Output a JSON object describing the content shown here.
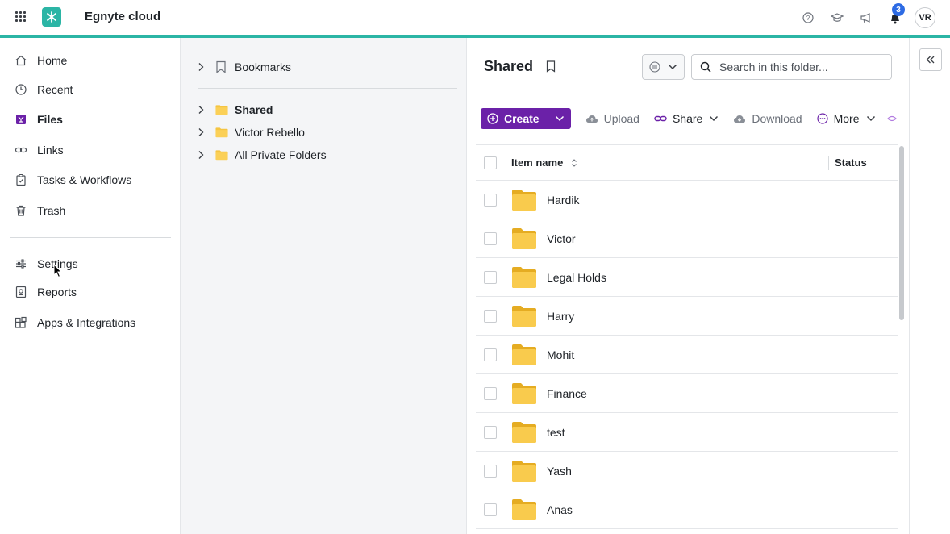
{
  "header": {
    "brand": "Egnyte cloud",
    "notification_count": "3",
    "avatar_initials": "VR"
  },
  "sidebar": {
    "items": [
      {
        "label": "Home",
        "icon": "home-icon"
      },
      {
        "label": "Recent",
        "icon": "clock-icon"
      },
      {
        "label": "Files",
        "icon": "files-icon",
        "active": true
      },
      {
        "label": "Links",
        "icon": "link-icon"
      },
      {
        "label": "Tasks & Workflows",
        "icon": "clipboard-check-icon"
      },
      {
        "label": "Trash",
        "icon": "trash-icon"
      },
      {
        "label": "Settings",
        "icon": "sliders-icon"
      },
      {
        "label": "Reports",
        "icon": "report-icon"
      },
      {
        "label": "Apps & Integrations",
        "icon": "apps-icon"
      }
    ]
  },
  "tree": {
    "bookmarks": "Bookmarks",
    "items": [
      {
        "label": "Shared",
        "selected": true
      },
      {
        "label": "Victor Rebello"
      },
      {
        "label": "All Private Folders"
      }
    ]
  },
  "main": {
    "title": "Shared",
    "search_placeholder": "Search in this folder...",
    "toolbar": {
      "create": "Create",
      "upload": "Upload",
      "share": "Share",
      "download": "Download",
      "more": "More"
    },
    "columns": {
      "name": "Item name",
      "status": "Status"
    },
    "rows": [
      {
        "name": "Hardik"
      },
      {
        "name": "Victor"
      },
      {
        "name": "Legal Holds"
      },
      {
        "name": "Harry"
      },
      {
        "name": "Mohit"
      },
      {
        "name": "Finance"
      },
      {
        "name": "test"
      },
      {
        "name": "Yash"
      },
      {
        "name": "Anas"
      }
    ]
  },
  "colors": {
    "accent_teal": "#2bb5a5",
    "create_purple": "#6b21a8",
    "folder_yellow": "#f5c542",
    "badge_blue": "#2d6be4"
  }
}
